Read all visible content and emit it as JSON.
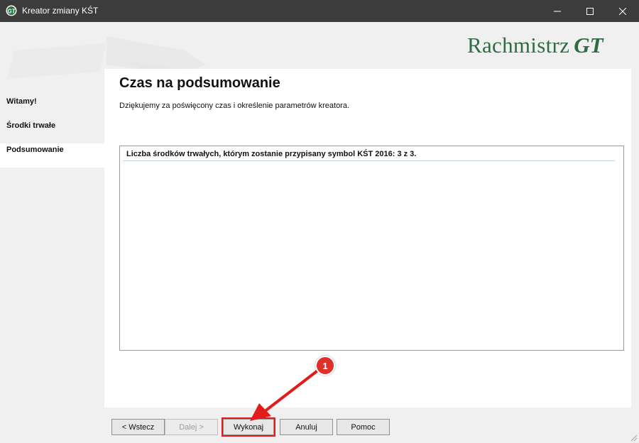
{
  "window": {
    "title": "Kreator zmiany KŚT",
    "icon": "app-logo-icon",
    "controls": [
      "minimize-icon",
      "maximize-icon",
      "close-icon"
    ]
  },
  "logo": {
    "word": "Rachmistrz",
    "mark": "GT",
    "color": "#2f6b45"
  },
  "sidebar": {
    "items": [
      {
        "label": "Witamy!"
      },
      {
        "label": "Środki trwałe"
      },
      {
        "label": "Podsumowanie",
        "active": true
      }
    ]
  },
  "main": {
    "heading": "Czas na podsumowanie",
    "description": "Dziękujemy za poświęcony czas i określenie parametrów kreatora.",
    "list": [
      "Liczba środków trwałych, którym zostanie przypisany symbol KŚT 2016:  3 z 3."
    ]
  },
  "buttons": {
    "back": "< Wstecz",
    "next": "Dalej >",
    "execute": "Wykonaj",
    "cancel": "Anuluj",
    "help": "Pomoc"
  },
  "annotation": {
    "number": "1",
    "color": "#e0302a"
  }
}
